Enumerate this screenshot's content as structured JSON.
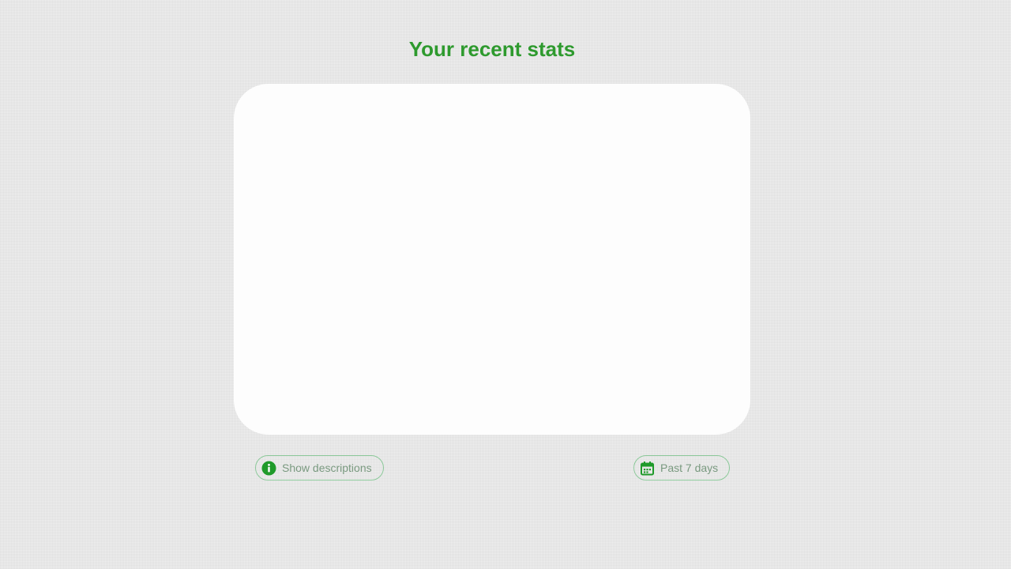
{
  "page": {
    "title": "Your recent stats"
  },
  "controls": {
    "descriptions_button": {
      "label": "Show descriptions",
      "icon": "info-icon"
    },
    "range_button": {
      "label": "Past 7 days",
      "icon": "calendar-icon"
    }
  },
  "colors": {
    "accent": "#2e9a2e",
    "border": "#8cc99a",
    "button_text": "#7a9a80",
    "card": "#fdfdfd"
  }
}
